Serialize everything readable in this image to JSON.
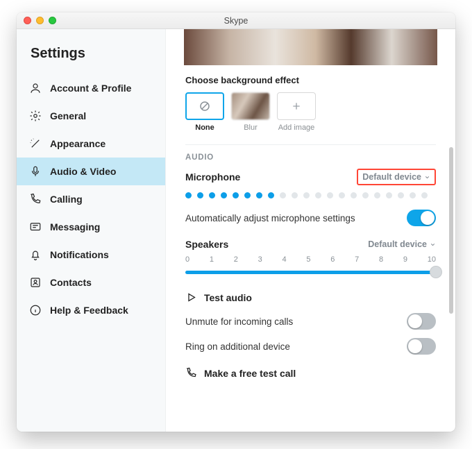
{
  "window": {
    "title": "Skype"
  },
  "sidebar": {
    "title": "Settings",
    "items": [
      {
        "label": "Account & Profile"
      },
      {
        "label": "General"
      },
      {
        "label": "Appearance"
      },
      {
        "label": "Audio & Video"
      },
      {
        "label": "Calling"
      },
      {
        "label": "Messaging"
      },
      {
        "label": "Notifications"
      },
      {
        "label": "Contacts"
      },
      {
        "label": "Help & Feedback"
      }
    ]
  },
  "content": {
    "bg_section_label": "Choose background effect",
    "bg_options": {
      "none": "None",
      "blur": "Blur",
      "add": "Add image"
    },
    "audio_header": "AUDIO",
    "mic_label": "Microphone",
    "mic_device": "Default device",
    "mic_level": {
      "active": 8,
      "total": 21
    },
    "auto_adjust_label": "Automatically adjust microphone settings",
    "auto_adjust_on": true,
    "speakers_label": "Speakers",
    "speakers_device": "Default device",
    "speaker_slider": {
      "min": 0,
      "max": 10,
      "value": 10,
      "ticks": [
        "0",
        "1",
        "2",
        "3",
        "4",
        "5",
        "6",
        "7",
        "8",
        "9",
        "10"
      ]
    },
    "test_audio_label": "Test audio",
    "unmute_label": "Unmute for incoming calls",
    "unmute_on": false,
    "ring_label": "Ring on additional device",
    "ring_on": false,
    "test_call_label": "Make a free test call"
  }
}
